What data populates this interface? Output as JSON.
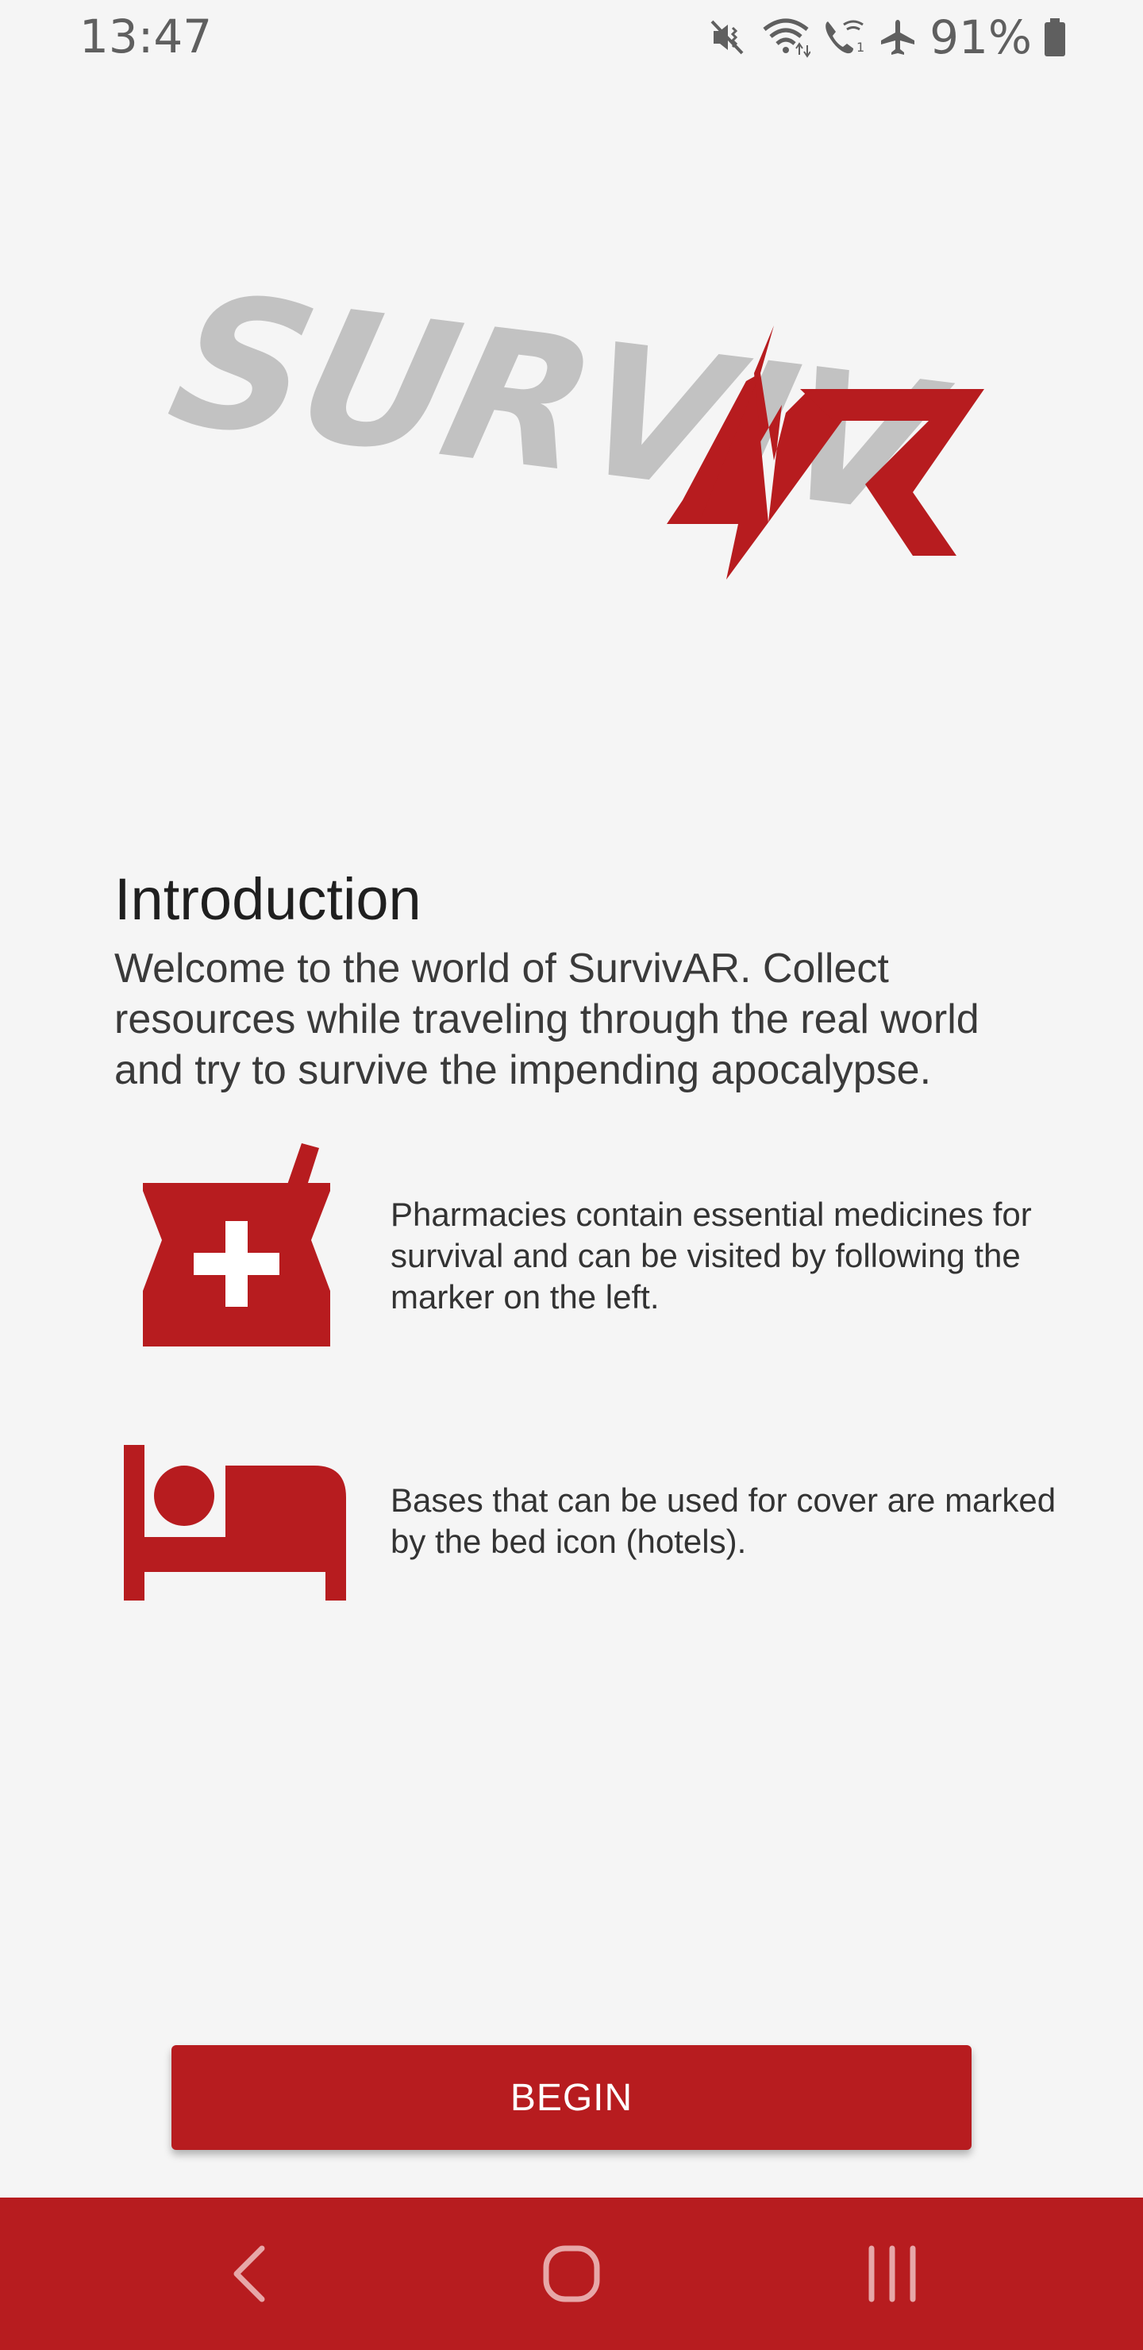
{
  "status_bar": {
    "time": "13:47",
    "battery_percent": "91%",
    "icons": [
      "mute-vibrate-icon",
      "wifi-icon",
      "wifi-calling-icon",
      "airplane-mode-icon",
      "battery-icon"
    ]
  },
  "logo": {
    "part_grey": "SURVIV",
    "part_red": "AR"
  },
  "intro": {
    "title": "Introduction",
    "text": "Welcome to the world of SurvivAR. Collect resources while traveling through the real world and try to survive the impending apocalypse."
  },
  "features": [
    {
      "icon": "pharmacy-icon",
      "text": "Pharmacies contain essential medicines for survival and can be visited by following the marker on the left."
    },
    {
      "icon": "bed-icon",
      "text": "Bases that can be used for cover are marked by the bed icon (hotels)."
    }
  ],
  "begin_button": {
    "label": "BEGIN"
  },
  "nav": {
    "icons": [
      "back-icon",
      "home-icon",
      "recents-icon"
    ]
  },
  "colors": {
    "accent": "#b71c1f",
    "background": "#f5f5f5",
    "logo_grey": "#c2c2c2"
  }
}
